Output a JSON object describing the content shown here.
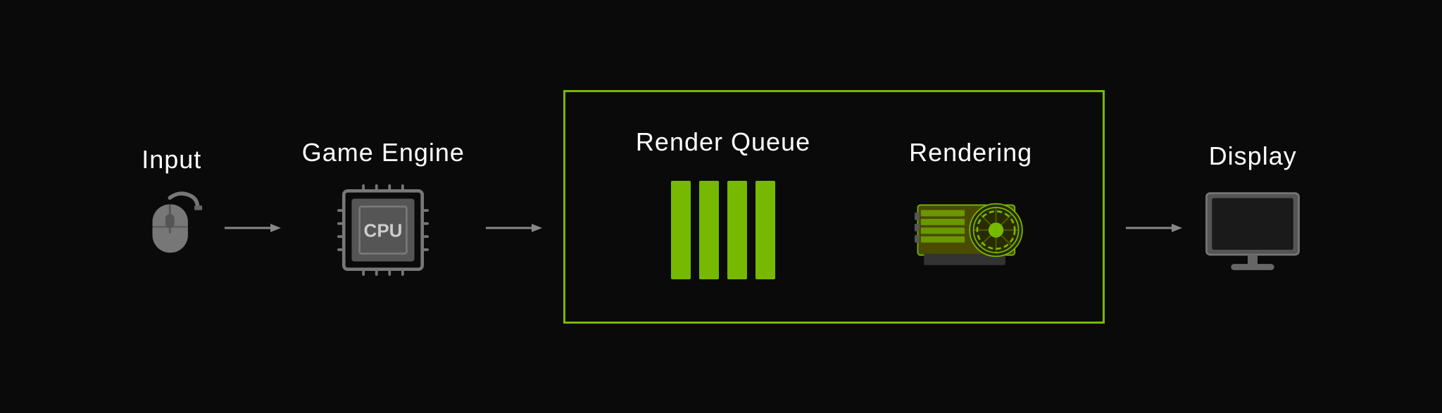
{
  "pipeline": {
    "stages": [
      {
        "id": "input",
        "label": "Input"
      },
      {
        "id": "game-engine",
        "label": "Game Engine"
      },
      {
        "id": "render-queue",
        "label": "Render Queue"
      },
      {
        "id": "rendering",
        "label": "Rendering"
      },
      {
        "id": "display",
        "label": "Display"
      }
    ],
    "cpu_label": "CPU",
    "accent_color": "#76b900",
    "arrow_color": "#888888",
    "icon_color": "#888888"
  }
}
